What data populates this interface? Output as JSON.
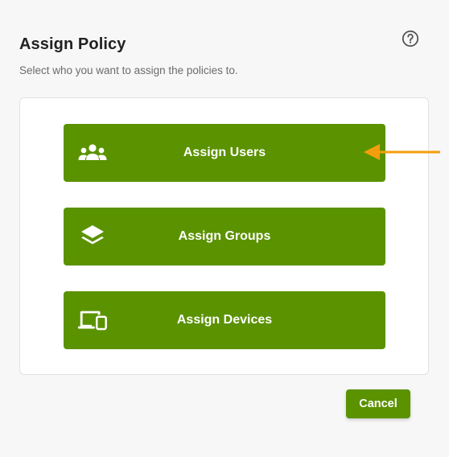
{
  "dialog": {
    "title": "Assign Policy",
    "subtitle": "Select who you want to assign the policies to.",
    "help_icon": "question-circle-icon"
  },
  "options": [
    {
      "label": "Assign Users",
      "icon": "users-icon"
    },
    {
      "label": "Assign Groups",
      "icon": "layers-icon"
    },
    {
      "label": "Assign Devices",
      "icon": "devices-icon"
    }
  ],
  "footer": {
    "cancel_label": "Cancel"
  },
  "colors": {
    "primary": "#5b9200",
    "annotation_arrow": "#f59e0b",
    "background": "#f7f7f7"
  }
}
